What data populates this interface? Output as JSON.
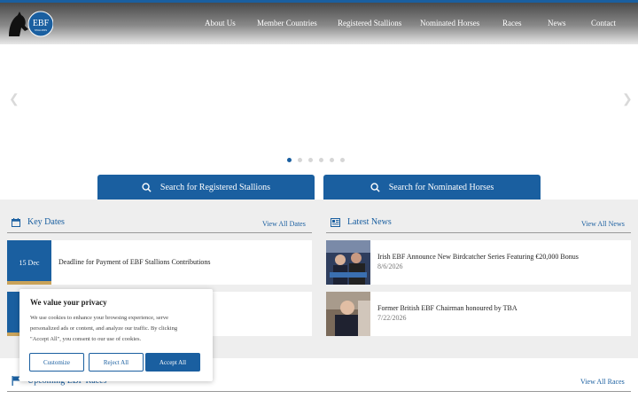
{
  "nav": {
    "items": [
      "About Us",
      "Member Countries",
      "Registered Stallions",
      "Nominated Horses",
      "Races",
      "News",
      "Contact"
    ]
  },
  "logo": {
    "text": "EBF",
    "sub": "STALLIONS"
  },
  "search": {
    "stallions": "Search for Registered Stallions",
    "horses": "Search for Nominated Horses"
  },
  "key_dates": {
    "title": "Key Dates",
    "link": "View All Dates",
    "items": [
      {
        "date": "15 Dec",
        "text": "Deadline for Payment of EBF Stallions Contributions"
      },
      {
        "date": "",
        "text": "D"
      }
    ]
  },
  "latest_news": {
    "title": "Latest News",
    "link": "View All News",
    "items": [
      {
        "title": "Irish EBF Announce New Birdcatcher Series Featuring €20,000 Bonus",
        "date": "8/6/2026"
      },
      {
        "title": "Former British EBF Chairman honoured by TBA",
        "date": "7/22/2026"
      }
    ]
  },
  "upcoming": {
    "title": "Upcoming EBF Races",
    "link": "View All Races"
  },
  "cookie": {
    "title": "We value your privacy",
    "body_lines": [
      "We use cookies to enhance your browsing experience, serve",
      "personalized ads or content, and analyze our traffic. By clicking",
      "\"Accept All\", you consent to our use of cookies."
    ],
    "customize": "Customize",
    "reject": "Reject All",
    "accept": "Accept All"
  },
  "colors": {
    "brand": "#1a5fa0",
    "gold": "#c9a35a",
    "grey_bg": "#eeeeee"
  }
}
